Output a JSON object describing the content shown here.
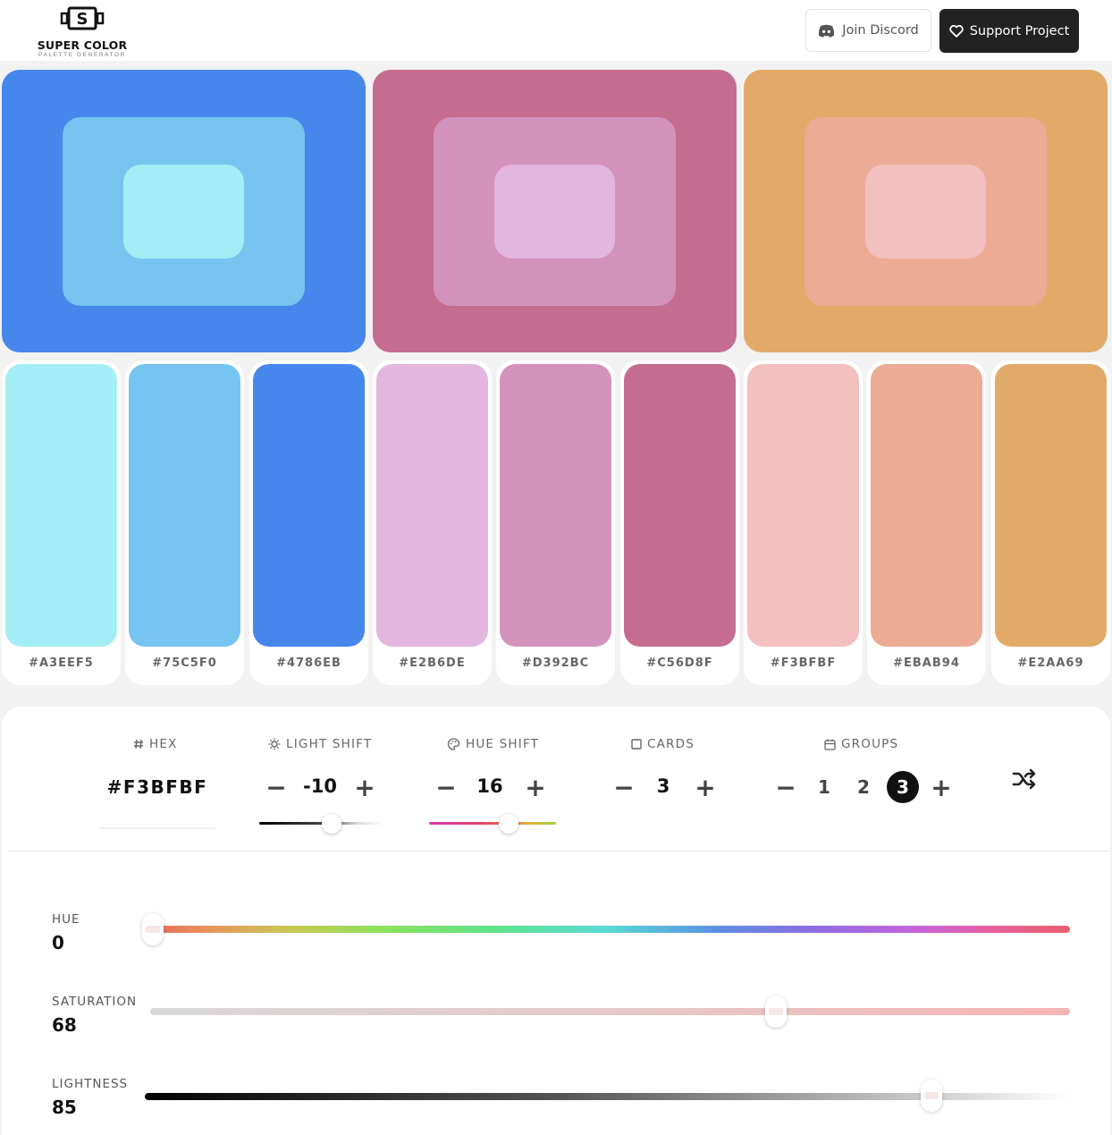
{
  "header": {
    "logo_title": "SUPER COLOR",
    "logo_subtitle": "PALETTE GENERATOR",
    "discord_label": "Join Discord",
    "support_label": "Support Project"
  },
  "groups_preview": [
    {
      "outer": "#4786EB",
      "mid": "#75C5F0",
      "inner": "#A3EEF5"
    },
    {
      "outer": "#C56D8F",
      "mid": "#D392BC",
      "inner": "#E2B6DE"
    },
    {
      "outer": "#E2AA69",
      "mid": "#EBAB94",
      "inner": "#F3BFBF"
    }
  ],
  "swatches": [
    {
      "hex": "#A3EEF5",
      "label": "#A3EEF5"
    },
    {
      "hex": "#75C5F0",
      "label": "#75C5F0"
    },
    {
      "hex": "#4786EB",
      "label": "#4786EB"
    },
    {
      "hex": "#E2B6DE",
      "label": "#E2B6DE"
    },
    {
      "hex": "#D392BC",
      "label": "#D392BC"
    },
    {
      "hex": "#C56D8F",
      "label": "#C56D8F"
    },
    {
      "hex": "#F3BFBF",
      "label": "#F3BFBF"
    },
    {
      "hex": "#EBAB94",
      "label": "#EBAB94"
    },
    {
      "hex": "#E2AA69",
      "label": "#E2AA69"
    }
  ],
  "controls": {
    "hex": {
      "label": "HEX",
      "value": "#F3BFBF"
    },
    "light_shift": {
      "label": "LIGHT SHIFT",
      "value": "-10",
      "slider_fraction": 0.58
    },
    "hue_shift": {
      "label": "HUE SHIFT",
      "value": "16",
      "slider_fraction": 0.63
    },
    "cards": {
      "label": "CARDS",
      "value": "3"
    },
    "groups": {
      "label": "GROUPS",
      "options": [
        "1",
        "2",
        "3"
      ],
      "selected": "3"
    },
    "minus": "−",
    "plus": "+"
  },
  "sliders": {
    "hue": {
      "label": "HUE",
      "value": "0",
      "fraction": 0.0
    },
    "saturation": {
      "label": "SATURATION",
      "value": "68",
      "fraction": 0.68
    },
    "lightness": {
      "label": "LIGHTNESS",
      "value": "85",
      "fraction": 0.85
    }
  }
}
